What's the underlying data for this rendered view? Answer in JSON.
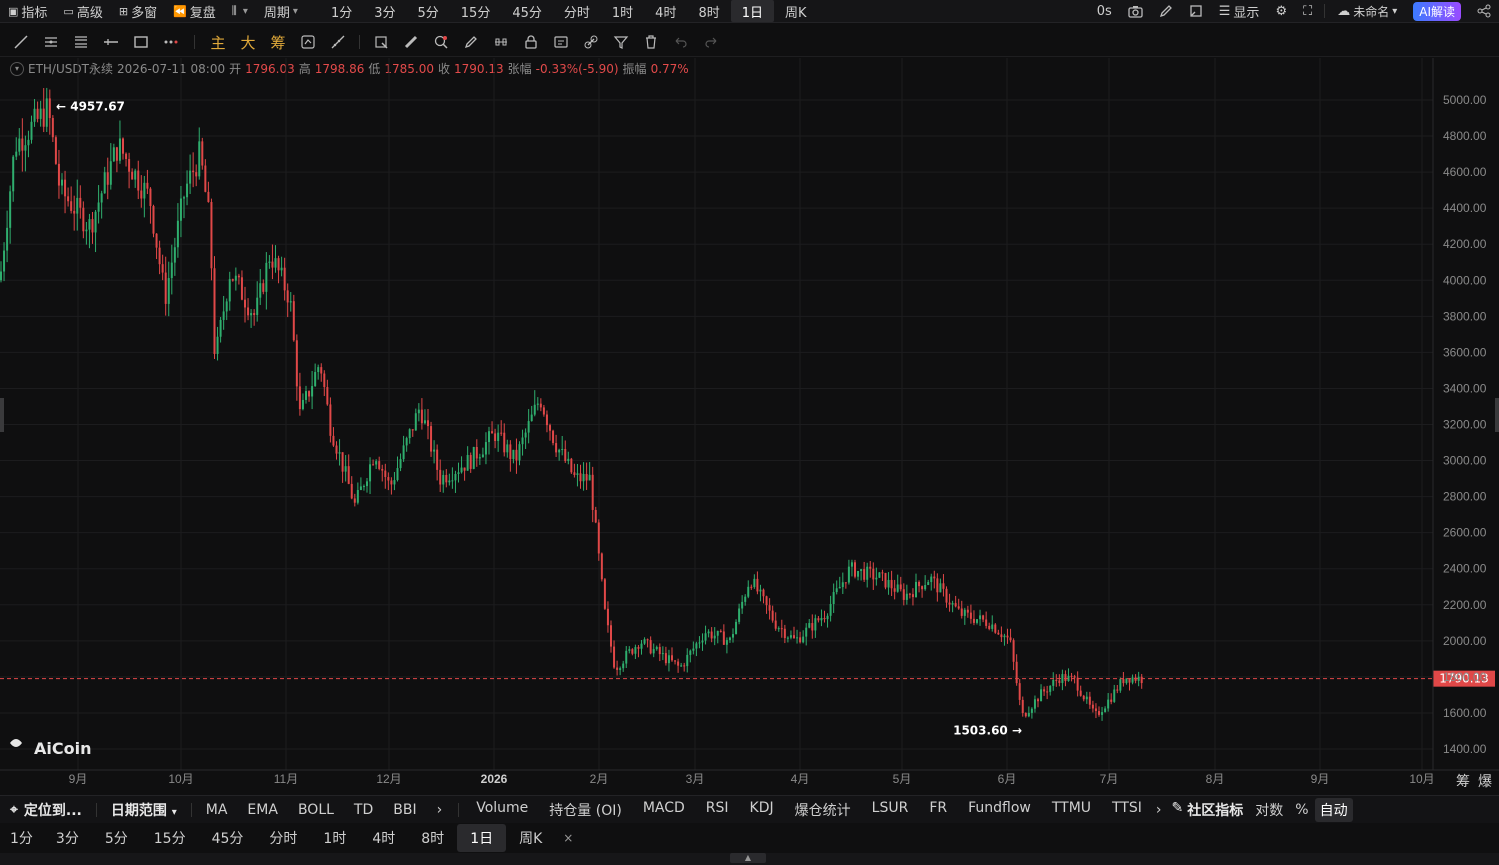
{
  "topbar": {
    "left": [
      {
        "label": "指标",
        "icon": "indicator-icon"
      },
      {
        "label": "高级",
        "icon": "window-icon"
      },
      {
        "label": "多窗",
        "icon": "grid-icon"
      },
      {
        "label": "复盘",
        "icon": "rewind-icon"
      },
      {
        "label": "",
        "icon": "chart-type-icon"
      },
      {
        "label": "周期"
      }
    ],
    "periods": [
      "1分",
      "3分",
      "5分",
      "15分",
      "45分",
      "分时",
      "1时",
      "4时",
      "8时",
      "1日",
      "周K"
    ],
    "active_period": "1日",
    "right": {
      "latency": "0s",
      "display_label": "显示",
      "layout_name": "未命名",
      "ai_label": "AI解读"
    }
  },
  "drawtools": {
    "text_tools": [
      "主",
      "大",
      "筹"
    ]
  },
  "ohlc": {
    "symbol": "ETH/USDT永续",
    "datetime": "2026-07-11 08:00",
    "open_label": "开",
    "open": "1796.03",
    "high_label": "高",
    "high": "1798.86",
    "low_label": "低",
    "low": "1785.00",
    "close_label": "收",
    "close": "1790.13",
    "change_label": "张幅",
    "change": "-0.33%(-5.90)",
    "amp_label": "振幅",
    "amp": "0.77%"
  },
  "chart_data": {
    "type": "candlestick",
    "y_ticks": [
      "5000.00",
      "4800.00",
      "4600.00",
      "4400.00",
      "4200.00",
      "4000.00",
      "3800.00",
      "3600.00",
      "3400.00",
      "3200.00",
      "3000.00",
      "2800.00",
      "2600.00",
      "2400.00",
      "2200.00",
      "2000.00",
      "1800.00",
      "1600.00",
      "1400.00"
    ],
    "ylim": [
      1400,
      5000
    ],
    "x_ticks": [
      "9月",
      "10月",
      "11月",
      "12月",
      "2026",
      "2月",
      "3月",
      "4月",
      "5月",
      "6月",
      "7月",
      "8月",
      "9月",
      "10月"
    ],
    "last_price": "1790.13",
    "high_marker": "4957.67",
    "low_marker": "1503.60",
    "up_color": "#2fae6e",
    "down_color": "#e04848",
    "watermark": "AiCoin",
    "axis_corner": [
      "筹",
      "爆"
    ]
  },
  "indicators_bar": {
    "locate": "定位到...",
    "date_range": "日期范围",
    "main": [
      "MA",
      "EMA",
      "BOLL",
      "TD",
      "BBI"
    ],
    "sub": [
      "Volume",
      "持仓量 (OI)",
      "MACD",
      "RSI",
      "KDJ",
      "爆仓统计",
      "LSUR",
      "FR",
      "Fundflow",
      "TTMU",
      "TTSI"
    ],
    "community": "社区指标",
    "log": "对数",
    "pct": "%",
    "auto": "自动"
  },
  "period_bar": {
    "items": [
      "1分",
      "3分",
      "5分",
      "15分",
      "45分",
      "分时",
      "1时",
      "4时",
      "8时",
      "1日",
      "周K"
    ],
    "active": "1日",
    "close": "×"
  }
}
